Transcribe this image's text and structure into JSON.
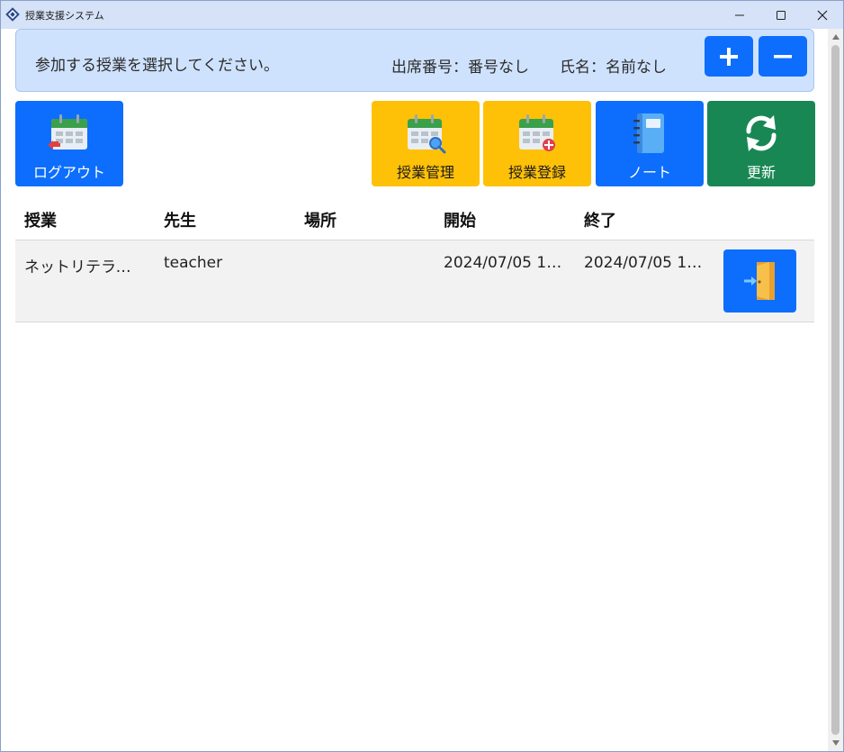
{
  "window": {
    "title": "授業支援システム",
    "minimize": "—",
    "maximize": "☐",
    "close": "✕"
  },
  "banner": {
    "message": "参加する授業を選択してください。",
    "attendance": "出席番号：番号なし",
    "name": "氏名：名前なし",
    "zoom_in": "+",
    "zoom_out": "−"
  },
  "toolbar": {
    "logout": "ログアウト",
    "class_manage": "授業管理",
    "class_register": "授業登録",
    "note": "ノート",
    "refresh": "更新"
  },
  "table": {
    "headers": [
      "授業",
      "先生",
      "場所",
      "開始",
      "終了"
    ],
    "rows": [
      {
        "class": "ネットリテラシー…",
        "teacher": "teacher",
        "place": "",
        "start": "2024/07/05 1…",
        "end": "2024/07/05 1…"
      }
    ]
  },
  "colors": {
    "primary": "#0d6efd",
    "warning": "#ffc107",
    "success": "#198754",
    "banner_bg": "#cfe2fd",
    "titlebar_bg": "#d6e2f7"
  }
}
